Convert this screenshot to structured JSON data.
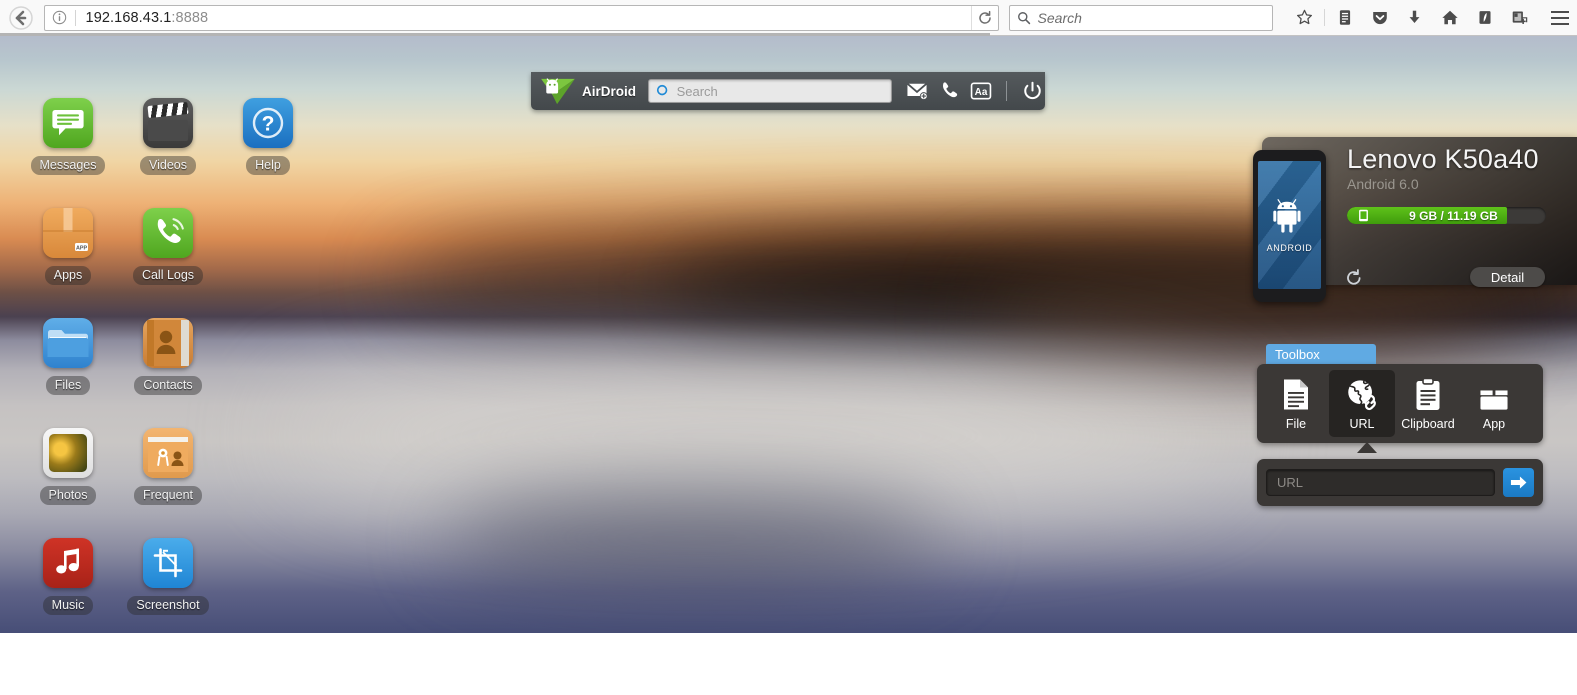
{
  "browser": {
    "name": "firefox",
    "back_icon": "back-arrow-icon",
    "identity_icon": "info-icon",
    "url_host": "192.168.43.1",
    "url_port": ":8888",
    "reload_icon": "reload-icon",
    "search_placeholder": "Search",
    "search_icon": "search-icon",
    "toolbar_icons": [
      {
        "name": "bookmark-star-icon",
        "glyph": "star"
      },
      {
        "name": "reading-list-icon",
        "glyph": "list"
      },
      {
        "name": "pocket-icon",
        "glyph": "shield"
      },
      {
        "name": "downloads-icon",
        "glyph": "down-arrow"
      },
      {
        "name": "home-icon",
        "glyph": "home"
      },
      {
        "name": "flash-icon",
        "glyph": "flash"
      },
      {
        "name": "screenshot-extension-icon",
        "glyph": "camera"
      }
    ],
    "menu_icon": "hamburger-menu-icon"
  },
  "airdroid_bar": {
    "logo_icon": "airdroid-logo-icon",
    "brand": "AirDroid",
    "search_placeholder": "Search",
    "search_icon": "airdroid-search-icon",
    "actions": [
      {
        "name": "new-message-button",
        "icon": "envelope-plus-icon"
      },
      {
        "name": "call-button",
        "icon": "phone-handset-icon"
      },
      {
        "name": "font-size-button",
        "icon": "aa-text-icon",
        "label": "Aa"
      },
      {
        "name": "power-button",
        "icon": "power-icon"
      }
    ]
  },
  "desktop": {
    "apps": [
      {
        "label": "Messages",
        "icon": "messages-icon",
        "cls": "ic-messages"
      },
      {
        "label": "Videos",
        "icon": "videos-icon",
        "cls": "ic-videos"
      },
      {
        "label": "Help",
        "icon": "help-icon",
        "cls": "ic-help"
      },
      {
        "label": "Apps",
        "icon": "apps-icon",
        "cls": "ic-apps"
      },
      {
        "label": "Call Logs",
        "icon": "call-logs-icon",
        "cls": "ic-calllogs"
      },
      {
        "label": "",
        "icon": "empty-slot",
        "cls": "ic-empty"
      },
      {
        "label": "Files",
        "icon": "files-icon",
        "cls": "ic-files"
      },
      {
        "label": "Contacts",
        "icon": "contacts-icon",
        "cls": "ic-contacts"
      },
      {
        "label": "",
        "icon": "empty-slot",
        "cls": "ic-empty"
      },
      {
        "label": "Photos",
        "icon": "photos-icon",
        "cls": "ic-photos"
      },
      {
        "label": "Frequent",
        "icon": "frequent-icon",
        "cls": "ic-frequent"
      },
      {
        "label": "",
        "icon": "empty-slot",
        "cls": "ic-empty"
      },
      {
        "label": "Music",
        "icon": "music-icon",
        "cls": "ic-music"
      },
      {
        "label": "Screenshot",
        "icon": "screenshot-icon",
        "cls": "ic-screenshot"
      }
    ]
  },
  "device": {
    "phone_screen_label": "ANDROID",
    "name": "Lenovo K50a40",
    "os": "Android 6.0",
    "storage_text": "9 GB / 11.19 GB",
    "storage_used_gb": 9,
    "storage_total_gb": 11.19,
    "storage_percent": 80.4,
    "storage_bar_color": "#4fb411",
    "storage_icon": "device-storage-icon",
    "refresh_icon": "refresh-icon",
    "detail_label": "Detail"
  },
  "toolbox": {
    "tab_label": "Toolbox",
    "tab_color": "#60aae3",
    "items": [
      {
        "label": "File",
        "icon": "file-document-icon",
        "active": false
      },
      {
        "label": "URL",
        "icon": "globe-link-icon",
        "active": true
      },
      {
        "label": "Clipboard",
        "icon": "clipboard-icon",
        "active": false
      },
      {
        "label": "App",
        "icon": "app-package-icon",
        "active": false
      }
    ],
    "url_input": {
      "placeholder": "URL",
      "value": "",
      "go_icon": "arrow-right-icon",
      "go_color": "#2189d6"
    }
  }
}
